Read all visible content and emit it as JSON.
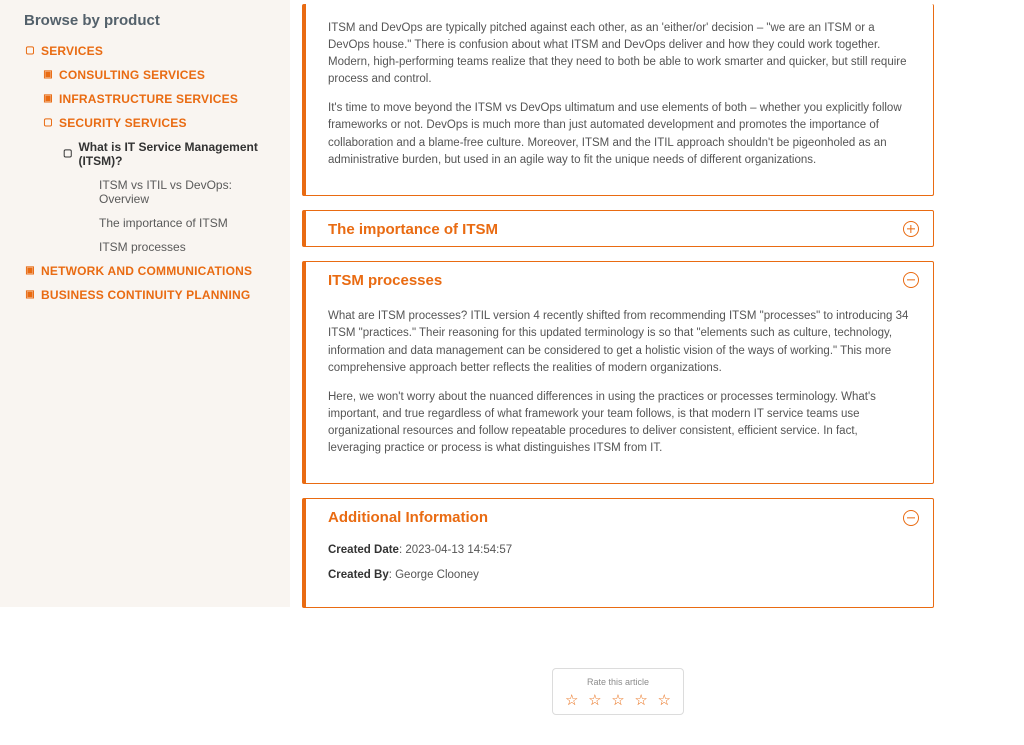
{
  "sidebar": {
    "heading": "Browse by product",
    "nodes": {
      "services": "SERVICES",
      "consulting": "CONSULTING SERVICES",
      "infrastructure": "INFRASTRUCTURE SERVICES",
      "security": "SECURITY SERVICES",
      "what_is_itsm": "What is IT Service Management (ITSM)?",
      "itsm_vs": "ITSM vs ITIL vs DevOps: Overview",
      "importance": "The importance of ITSM",
      "processes": "ITSM processes",
      "network": "NETWORK AND COMMUNICATIONS",
      "bcp": "BUSINESS CONTINUITY PLANNING"
    }
  },
  "card_top": {
    "p1": "ITSM and DevOps are typically pitched against each other, as an 'either/or' decision – \"we are an ITSM or a DevOps house.\" There is confusion about what ITSM and DevOps deliver and how they could work together. Modern, high-performing teams realize that they need to both be able to work smarter and quicker, but still require process and control.",
    "p2": "It's time to move beyond the ITSM vs DevOps ultimatum and use elements of both – whether you explicitly follow frameworks or not. DevOps is much more than just automated development and promotes the importance of collaboration and a blame-free culture. Moreover, ITSM and the ITIL approach shouldn't be pigeonholed as an administrative burden, but used in an agile way to fit the unique needs of different organizations."
  },
  "card_importance": {
    "title": "The importance of ITSM"
  },
  "card_processes": {
    "title": "ITSM processes",
    "p1": "What are ITSM processes? ITIL version 4 recently shifted from recommending ITSM \"processes\" to introducing 34 ITSM \"practices.\" Their reasoning for this updated terminology is so that \"elements such as culture, technology, information and data management can be considered to get a holistic vision of the ways of working.\" This more comprehensive approach better reflects the realities of modern organizations.",
    "p2": "Here, we won't worry about the nuanced differences in using the practices or processes terminology. What's important, and true regardless of what framework your team follows, is that modern IT service teams use organizational resources and follow repeatable procedures to deliver consistent, efficient service. In fact, leveraging practice or process is what distinguishes ITSM from IT."
  },
  "card_info": {
    "title": "Additional Information",
    "created_date_label": "Created Date",
    "created_date_value": "2023-04-13 14:54:57",
    "created_by_label": "Created By",
    "created_by_value": "George Clooney"
  },
  "rating": {
    "label": "Rate this article"
  }
}
